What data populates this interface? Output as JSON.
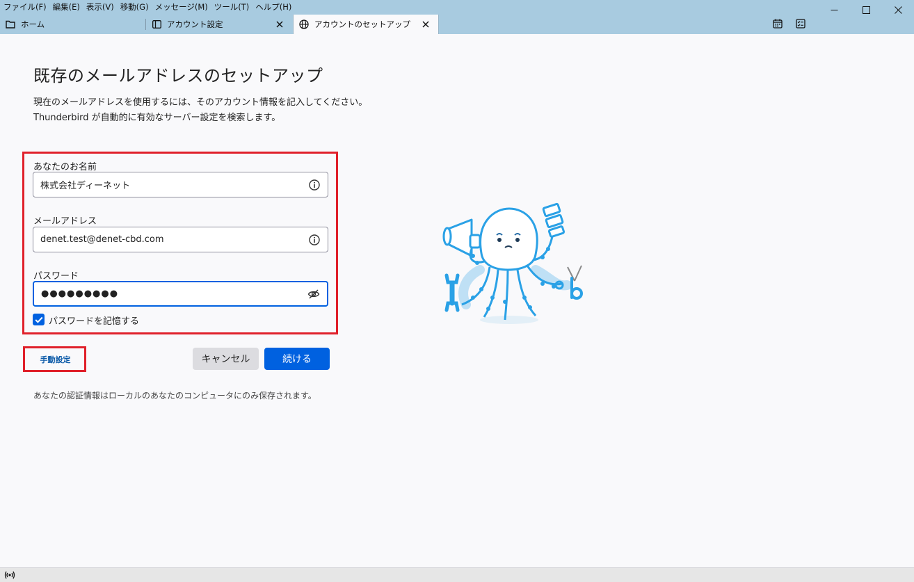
{
  "menu": [
    "ファイル(F)",
    "編集(E)",
    "表示(V)",
    "移動(G)",
    "メッセージ(M)",
    "ツール(T)",
    "ヘルプ(H)"
  ],
  "tabs": [
    {
      "label": "ホーム",
      "icon": "folder-icon"
    },
    {
      "label": "アカウント設定",
      "icon": "sidebar-panel-icon"
    },
    {
      "label": "アカウントのセットアップ",
      "icon": "globe-icon"
    }
  ],
  "page": {
    "title": "既存のメールアドレスのセットアップ",
    "description_line1": "現在のメールアドレスを使用するには、そのアカウント情報を記入してください。",
    "description_line2": "Thunderbird が自動的に有効なサーバー設定を検索します。"
  },
  "form": {
    "name_label": "あなたのお名前",
    "name_value": "株式会社ディーネット",
    "email_label": "メールアドレス",
    "email_value": "denet.test@denet-cbd.com",
    "password_label": "パスワード",
    "password_value": "●●●●●●●●●",
    "remember_label": "パスワードを記憶する",
    "remember_checked": true
  },
  "buttons": {
    "manual": "手動設定",
    "cancel": "キャンセル",
    "continue": "続ける"
  },
  "note": "あなたの認証情報はローカルのあなたのコンピュータにのみ保存されます。",
  "colors": {
    "accent": "#0061e0",
    "highlight_box": "#e0202a",
    "chrome": "#a8cbe0",
    "mascot": "#2aa1e6"
  }
}
